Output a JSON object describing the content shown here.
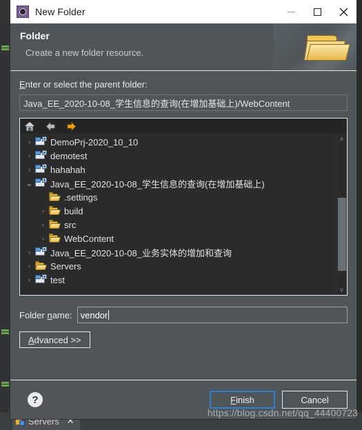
{
  "window": {
    "title": "New Folder",
    "icon": "eclipse-wizard-icon",
    "minimize_label": "—",
    "maximize_label": "□",
    "close_label": "✕"
  },
  "header": {
    "title": "Folder",
    "subtitle": "Create a new folder resource.",
    "banner_icon": "folder-banner-icon"
  },
  "parent_folder": {
    "label_prefix": "E",
    "label_rest": "nter or select the parent folder:",
    "value": "Java_EE_2020-10-08_学生信息的查询(在增加基础上)/WebContent"
  },
  "tree_toolbar": {
    "home": "home-icon",
    "back": "back-arrow-icon",
    "forward": "forward-arrow-icon"
  },
  "tree": {
    "items": [
      {
        "label": "DemoPrj-2020_10_10",
        "icon": "project-icon",
        "indent": 0,
        "twisty": "collapsed"
      },
      {
        "label": "demotest",
        "icon": "project-icon",
        "indent": 0,
        "twisty": "collapsed"
      },
      {
        "label": "hahahah",
        "icon": "project-icon",
        "indent": 0,
        "twisty": "collapsed"
      },
      {
        "label": "Java_EE_2020-10-08_学生信息的查询(在增加基础上)",
        "icon": "project-icon",
        "indent": 0,
        "twisty": "expanded"
      },
      {
        "label": ".settings",
        "icon": "folder-icon",
        "indent": 1,
        "twisty": "none"
      },
      {
        "label": "build",
        "icon": "folder-icon",
        "indent": 1,
        "twisty": "collapsed"
      },
      {
        "label": "src",
        "icon": "folder-icon",
        "indent": 1,
        "twisty": "collapsed"
      },
      {
        "label": "WebContent",
        "icon": "folder-icon",
        "indent": 1,
        "twisty": "collapsed"
      },
      {
        "label": "Java_EE_2020-10-08_业务实体的增加和查询",
        "icon": "project-icon",
        "indent": 0,
        "twisty": "collapsed"
      },
      {
        "label": "Servers",
        "icon": "folder-icon",
        "indent": 0,
        "twisty": "collapsed"
      },
      {
        "label": "test",
        "icon": "project-icon",
        "indent": 0,
        "twisty": "collapsed"
      }
    ],
    "scroll_up": "˄",
    "scroll_down": "˅"
  },
  "folder_name": {
    "label_prefix": "Folder ",
    "label_underlined": "n",
    "label_suffix": "ame:",
    "value": "vendor"
  },
  "advanced": {
    "label_underlined": "A",
    "label_rest": "dvanced >>"
  },
  "footer": {
    "help": "?",
    "finish_underlined": "F",
    "finish_rest": "inish",
    "cancel": "Cancel",
    "watermark": "https://blog.csdn.net/qq_44400723"
  },
  "backdrop": {
    "tab_label": "Servers",
    "tab_close": "✕"
  },
  "colors": {
    "dialog_bg": "#4f5559",
    "tree_bg": "#2b2b2b",
    "accent_blue": "#2f7fd0",
    "folder_yellow": "#e8b949",
    "titlebar_bg": "#ffffff"
  }
}
